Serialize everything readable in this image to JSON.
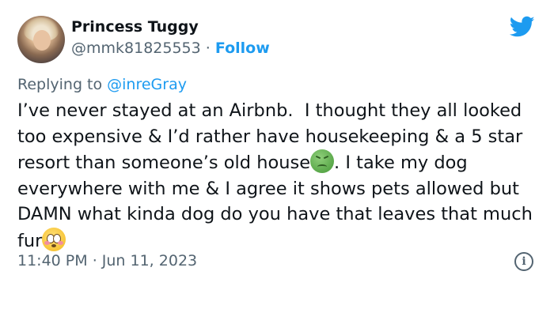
{
  "author": {
    "name": "Princess Tuggy",
    "handle": "@mmk81825553",
    "separator": " · ",
    "follow_label": "Follow"
  },
  "reply": {
    "prefix": "Replying to ",
    "mention": "@inreGray"
  },
  "tweet": {
    "text_part1": "I’ve never stayed at an Airbnb.  I thought they all looked too expensive & I’d rather have housekeeping & a 5 star resort than someone’s old house",
    "text_part2": ". I take my dog everywhere with me & I agree it shows pets allowed but DAMN what kinda dog do you have that leaves that much fur",
    "emoji1": "sick-face-emoji",
    "emoji2": "flushed-face-emoji"
  },
  "meta": {
    "time": "11:40 PM",
    "separator": " · ",
    "date": "Jun 11, 2023"
  },
  "icons": {
    "brand": "twitter-bird-icon",
    "info": "info-icon"
  },
  "colors": {
    "accent": "#1d9bf0",
    "text": "#0f1419",
    "secondary": "#536471"
  }
}
